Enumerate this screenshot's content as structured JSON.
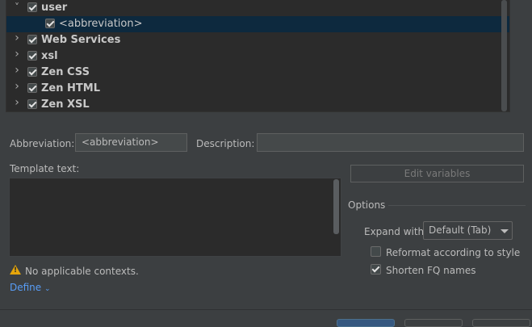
{
  "tree": {
    "items": [
      {
        "label": "user",
        "expanded": true,
        "checked": true,
        "bold": true,
        "level": 0,
        "selected": false
      },
      {
        "label": "<abbreviation>",
        "checked": true,
        "bold": false,
        "level": 1,
        "selected": true
      },
      {
        "label": "Web Services",
        "expanded": false,
        "checked": true,
        "bold": true,
        "level": 0,
        "selected": false
      },
      {
        "label": "xsl",
        "expanded": false,
        "checked": true,
        "bold": true,
        "level": 0,
        "selected": false
      },
      {
        "label": "Zen CSS",
        "expanded": false,
        "checked": true,
        "bold": true,
        "level": 0,
        "selected": false
      },
      {
        "label": "Zen HTML",
        "expanded": false,
        "checked": true,
        "bold": true,
        "level": 0,
        "selected": false
      },
      {
        "label": "Zen XSL",
        "expanded": false,
        "checked": true,
        "bold": true,
        "level": 0,
        "selected": false
      }
    ]
  },
  "form": {
    "abbreviation_label": "Abbreviation:",
    "abbreviation_value": "<abbreviation>",
    "description_label": "Description:",
    "description_value": "",
    "template_label": "Template text:",
    "template_value": "",
    "edit_variables_label": "Edit variables",
    "warning_text": "No applicable contexts.",
    "define_label": "Define"
  },
  "options": {
    "title": "Options",
    "expand_with_label": "Expand with",
    "expand_with_value": "Default (Tab)",
    "reformat_label": "Reformat according to style",
    "reformat_checked": false,
    "shorten_label": "Shorten FQ names",
    "shorten_checked": true
  },
  "colors": {
    "background": "#3c3f41",
    "tree_background": "#2b2b2b",
    "selection": "#0d293e",
    "link": "#589df6",
    "warning": "#e5a50a",
    "primary_button": "#365880"
  }
}
